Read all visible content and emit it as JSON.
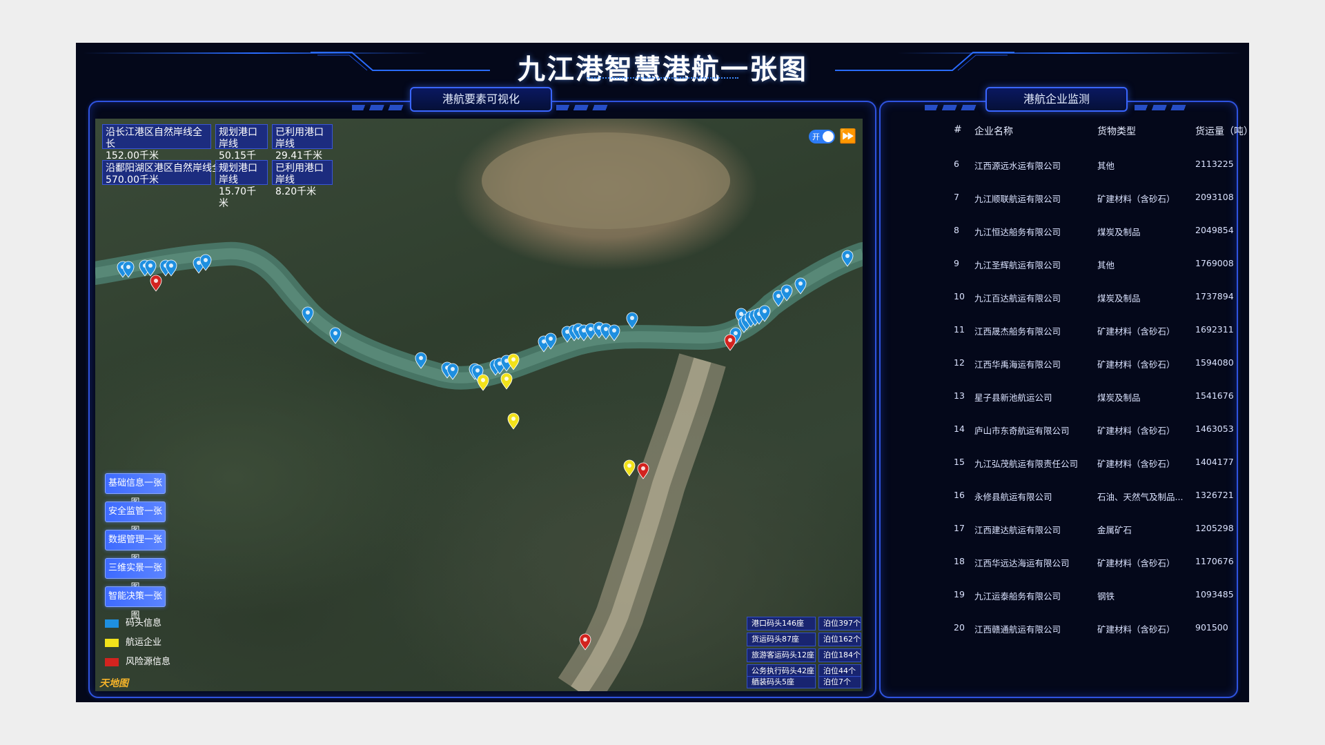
{
  "header": {
    "title": "九江港智慧港航一张图"
  },
  "left_panel": {
    "tab_label": "港航要素可视化"
  },
  "right_panel": {
    "tab_label": "港航企业监测"
  },
  "stats": [
    {
      "label": "沿长江港区自然岸线全长",
      "value": "152.00千米"
    },
    {
      "label": "规划港口岸线",
      "value": "50.15千米"
    },
    {
      "label": "已利用港口岸线",
      "value": "29.41千米"
    },
    {
      "label": "沿鄱阳湖区港区自然岸线全长",
      "value": "570.00千米"
    },
    {
      "label": "规划港口岸线",
      "value": "15.70千米"
    },
    {
      "label": "已利用港口岸线",
      "value": "8.20千米"
    }
  ],
  "toggle": {
    "label": "开"
  },
  "side_buttons": [
    "基础信息一张图",
    "安全监管一张图",
    "数据管理一张图",
    "三维实景一张图",
    "智能决策一张图"
  ],
  "legend": [
    {
      "label": "码头信息",
      "color": "#1e8fe0"
    },
    {
      "label": "航运企业",
      "color": "#f2e21b"
    },
    {
      "label": "风险源信息",
      "color": "#d3231f"
    }
  ],
  "logo_text": "天地图",
  "dock_stats": [
    {
      "name": "港口码头146座",
      "berth": "泊位397个"
    },
    {
      "name": "货运码头87座",
      "berth": "泊位162个"
    },
    {
      "name": "旅游客运码头12座",
      "berth": "泊位184个"
    },
    {
      "name": "公务执行码头42座",
      "berth": "泊位44个"
    },
    {
      "name": "舾装码头5座",
      "berth": "泊位7个"
    }
  ],
  "table": {
    "headers": [
      "#",
      "企业名称",
      "货物类型",
      "货运量（吨）"
    ],
    "rows": [
      [
        "6",
        "江西源远水运有限公司",
        "其他",
        "2113225"
      ],
      [
        "7",
        "九江顺联航运有限公司",
        "矿建材料（含砂石）",
        "2093108"
      ],
      [
        "8",
        "九江恒达船务有限公司",
        "煤炭及制品",
        "2049854"
      ],
      [
        "9",
        "九江圣辉航运有限公司",
        "其他",
        "1769008"
      ],
      [
        "10",
        "九江百达航运有限公司",
        "煤炭及制品",
        "1737894"
      ],
      [
        "11",
        "江西晟杰船务有限公司",
        "矿建材料（含砂石）",
        "1692311"
      ],
      [
        "12",
        "江西华禹海运有限公司",
        "矿建材料（含砂石）",
        "1594080"
      ],
      [
        "13",
        "星子县新池航运公司",
        "煤炭及制品",
        "1541676"
      ],
      [
        "14",
        "庐山市东奇航运有限公司",
        "矿建材料（含砂石）",
        "1463053"
      ],
      [
        "15",
        "九江弘茂航运有限责任公司",
        "矿建材料（含砂石）",
        "1404177"
      ],
      [
        "16",
        "永修县航运有限公司",
        "石油、天然气及制品...",
        "1326721"
      ],
      [
        "17",
        "江西建达航运有限公司",
        "金属矿石",
        "1205298"
      ],
      [
        "18",
        "江西华远达海运有限公司",
        "矿建材料（含砂石）",
        "1170676"
      ],
      [
        "19",
        "九江运泰船务有限公司",
        "钢铁",
        "1093485"
      ],
      [
        "20",
        "江西赣通航运有限公司",
        "矿建材料（含砂石）",
        "901500"
      ]
    ]
  },
  "markers": {
    "blue": [
      [
        40,
        230
      ],
      [
        48,
        230
      ],
      [
        72,
        228
      ],
      [
        80,
        228
      ],
      [
        102,
        228
      ],
      [
        110,
        228
      ],
      [
        150,
        224
      ],
      [
        160,
        220
      ],
      [
        308,
        296
      ],
      [
        348,
        326
      ],
      [
        472,
        362
      ],
      [
        510,
        376
      ],
      [
        518,
        378
      ],
      [
        550,
        378
      ],
      [
        554,
        380
      ],
      [
        580,
        372
      ],
      [
        586,
        370
      ],
      [
        596,
        366
      ],
      [
        650,
        338
      ],
      [
        660,
        334
      ],
      [
        684,
        324
      ],
      [
        694,
        322
      ],
      [
        700,
        320
      ],
      [
        708,
        322
      ],
      [
        718,
        320
      ],
      [
        730,
        318
      ],
      [
        740,
        320
      ],
      [
        752,
        322
      ],
      [
        778,
        304
      ],
      [
        928,
        326
      ],
      [
        936,
        298
      ],
      [
        940,
        310
      ],
      [
        944,
        306
      ],
      [
        950,
        302
      ],
      [
        956,
        300
      ],
      [
        962,
        298
      ],
      [
        970,
        294
      ],
      [
        990,
        272
      ],
      [
        1002,
        264
      ],
      [
        1022,
        254
      ],
      [
        1090,
        214
      ]
    ],
    "yellow": [
      [
        562,
        394
      ],
      [
        596,
        392
      ],
      [
        606,
        364
      ],
      [
        606,
        450
      ],
      [
        774,
        518
      ]
    ],
    "red": [
      [
        88,
        250
      ],
      [
        920,
        336
      ],
      [
        794,
        522
      ],
      [
        710,
        770
      ]
    ]
  }
}
